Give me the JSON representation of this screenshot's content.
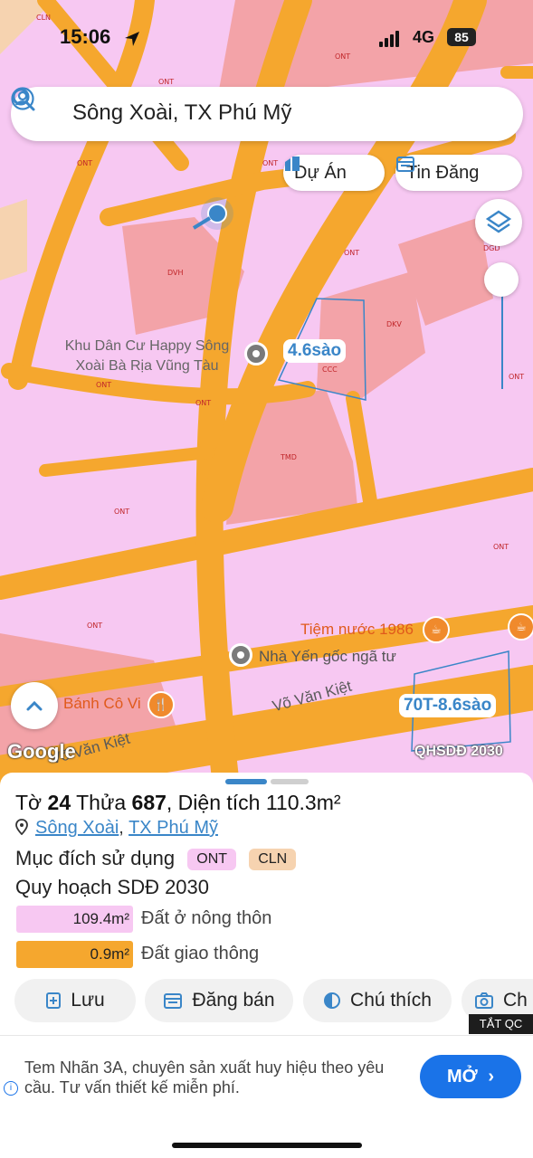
{
  "status": {
    "time": "15:06",
    "network": "4G",
    "battery": "85"
  },
  "search": {
    "text": "Sông Xoài, TX Phú Mỹ"
  },
  "chips": {
    "du_an": "Dự Án",
    "tin_dang": "Tin Đăng"
  },
  "map": {
    "zone_labels": [
      "CLN",
      "ONT",
      "ONT",
      "ONT",
      "ONT",
      "DVH",
      "ONT",
      "DGD",
      "DKV",
      "ONT",
      "ONT",
      "CCC",
      "ONT",
      "TMD",
      "ONT",
      "ONT",
      "ONT"
    ],
    "place_happy": "Khu Dân Cư Happy Sông Xoài Bà Rịa Vũng Tàu",
    "parcel_1": "4.6sào",
    "parcel_2": "70T-8.6sào",
    "poi_tiem_nuoc": "Tiệm nước 1986",
    "poi_nha_yen": "Nhà Yến gốc ngã tư",
    "poi_banh": "Bánh Cô Vi",
    "road_1": "Võ Văn Kiệt",
    "road_2": "Võ Văn Kiệt",
    "google": "Google",
    "plan_tag": "QHSDĐ 2030"
  },
  "sheet": {
    "title_pre": "Tờ ",
    "sheet_no": "24",
    "title_mid": " Thửa ",
    "parcel_no": "687",
    "title_post": ", Diện tích 110.3m²",
    "ward": "Sông Xoài",
    "town": "TX Phú Mỹ",
    "purpose_label": "Mục đích sử dụng",
    "badge_ont": "ONT",
    "badge_cln": "CLN",
    "plan_title": "Quy hoạch SDĐ 2030",
    "plan_rows": [
      {
        "value": "109.4m²",
        "label": "Đất ở nông thôn",
        "color": "#f7c8f2"
      },
      {
        "value": "0.9m²",
        "label": "Đất giao thông",
        "color": "#f5a72e"
      }
    ]
  },
  "actions": {
    "luu": "Lưu",
    "dang_ban": "Đăng bán",
    "chu_thich": "Chú thích",
    "chup": "Ch",
    "tat_qc": "TẮT QC"
  },
  "ad": {
    "text": "Tem Nhãn 3A, chuyên sản xuất huy hiệu theo yêu cầu. Tư vấn thiết kế miễn phí.",
    "button": "MỞ"
  },
  "colors": {
    "residential": "#f7c8f2",
    "road": "#f5a72e",
    "commercial": "#f3a3a8",
    "accent": "#3a86c8"
  }
}
